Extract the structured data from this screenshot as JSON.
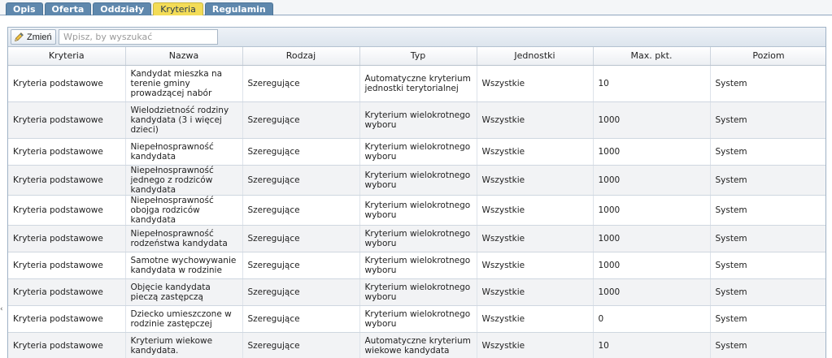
{
  "tabs": [
    {
      "label": "Opis",
      "active": false
    },
    {
      "label": "Oferta",
      "active": false
    },
    {
      "label": "Oddziały",
      "active": false
    },
    {
      "label": "Kryteria",
      "active": true
    },
    {
      "label": "Regulamin",
      "active": false
    }
  ],
  "toolbar": {
    "edit_label": "Zmień",
    "search_placeholder": "Wpisz, by wyszukać",
    "search_value": ""
  },
  "table": {
    "columns": [
      "Kryteria",
      "Nazwa",
      "Rodzaj",
      "Typ",
      "Jednostki",
      "Max. pkt.",
      "Poziom"
    ],
    "rows": [
      {
        "kryteria": "Kryteria podstawowe",
        "nazwa": "Kandydat mieszka na terenie gminy prowadzącej nabór",
        "rodzaj": "Szeregujące",
        "typ": "Automatyczne kryterium jednostki terytorialnej",
        "jednostki": "Wszystkie",
        "max": "10",
        "poziom": "System"
      },
      {
        "kryteria": "Kryteria podstawowe",
        "nazwa": "Wielodzietność rodziny kandydata (3 i więcej dzieci)",
        "rodzaj": "Szeregujące",
        "typ": "Kryterium wielokrotnego wyboru",
        "jednostki": "Wszystkie",
        "max": "1000",
        "poziom": "System"
      },
      {
        "kryteria": "Kryteria podstawowe",
        "nazwa": "Niepełnosprawność kandydata",
        "rodzaj": "Szeregujące",
        "typ": "Kryterium wielokrotnego wyboru",
        "jednostki": "Wszystkie",
        "max": "1000",
        "poziom": "System"
      },
      {
        "kryteria": "Kryteria podstawowe",
        "nazwa": "Niepełnosprawność jednego z rodziców kandydata",
        "rodzaj": "Szeregujące",
        "typ": "Kryterium wielokrotnego wyboru",
        "jednostki": "Wszystkie",
        "max": "1000",
        "poziom": "System"
      },
      {
        "kryteria": "Kryteria podstawowe",
        "nazwa": "Niepełnosprawność obojga rodziców kandydata",
        "rodzaj": "Szeregujące",
        "typ": "Kryterium wielokrotnego wyboru",
        "jednostki": "Wszystkie",
        "max": "1000",
        "poziom": "System"
      },
      {
        "kryteria": "Kryteria podstawowe",
        "nazwa": "Niepełnosprawność rodzeństwa kandydata",
        "rodzaj": "Szeregujące",
        "typ": "Kryterium wielokrotnego wyboru",
        "jednostki": "Wszystkie",
        "max": "1000",
        "poziom": "System"
      },
      {
        "kryteria": "Kryteria podstawowe",
        "nazwa": "Samotne wychowywanie kandydata w rodzinie",
        "rodzaj": "Szeregujące",
        "typ": "Kryterium wielokrotnego wyboru",
        "jednostki": "Wszystkie",
        "max": "1000",
        "poziom": "System"
      },
      {
        "kryteria": "Kryteria podstawowe",
        "nazwa": "Objęcie kandydata pieczą zastępczą",
        "rodzaj": "Szeregujące",
        "typ": "Kryterium wielokrotnego wyboru",
        "jednostki": "Wszystkie",
        "max": "1000",
        "poziom": "System"
      },
      {
        "kryteria": "Kryteria podstawowe",
        "nazwa": "Dziecko umieszczone w rodzinie zastępczej",
        "rodzaj": "Szeregujące",
        "typ": "Kryterium wielokrotnego wyboru",
        "jednostki": "Wszystkie",
        "max": "0",
        "poziom": "System"
      },
      {
        "kryteria": "Kryteria podstawowe",
        "nazwa": "Kryterium wiekowe kandydata.",
        "rodzaj": "Szeregujące",
        "typ": "Automatyczne kryterium wiekowe kandydata",
        "jednostki": "Wszystkie",
        "max": "10",
        "poziom": "System"
      }
    ]
  }
}
